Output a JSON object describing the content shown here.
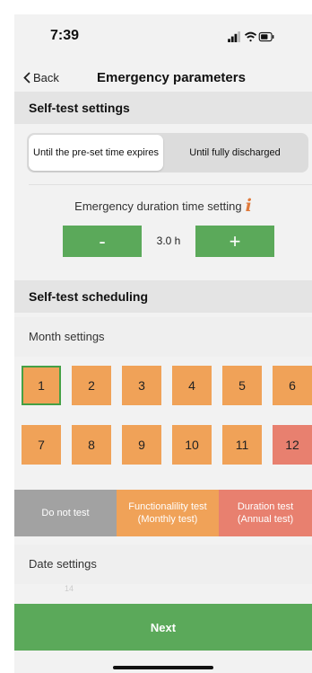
{
  "status_bar": {
    "time": "7:39"
  },
  "nav": {
    "back_label": "Back",
    "title": "Emergency parameters"
  },
  "self_test_settings": {
    "header": "Self-test settings",
    "segments": [
      {
        "label": "Until the pre-set time expires",
        "selected": true
      },
      {
        "label": "Until fully discharged",
        "selected": false
      }
    ],
    "duration_label": "Emergency duration time setting",
    "info_icon": "i",
    "decrement_label": "-",
    "increment_label": "+",
    "duration_value": "3.0 h"
  },
  "self_test_scheduling": {
    "header": "Self-test scheduling",
    "month_settings_label": "Month settings",
    "months": [
      {
        "label": "1",
        "state": "functionality",
        "selected": true
      },
      {
        "label": "2",
        "state": "functionality"
      },
      {
        "label": "3",
        "state": "functionality"
      },
      {
        "label": "4",
        "state": "functionality"
      },
      {
        "label": "5",
        "state": "functionality"
      },
      {
        "label": "6",
        "state": "functionality"
      },
      {
        "label": "7",
        "state": "functionality"
      },
      {
        "label": "8",
        "state": "functionality"
      },
      {
        "label": "9",
        "state": "functionality"
      },
      {
        "label": "10",
        "state": "functionality"
      },
      {
        "label": "11",
        "state": "functionality"
      },
      {
        "label": "12",
        "state": "duration"
      }
    ],
    "legend": {
      "none": "Do not test",
      "functionality_line1": "Functionalility test",
      "functionality_line2": "(Monthly test)",
      "duration_line1": "Duration test",
      "duration_line2": "(Annual test)"
    },
    "date_settings_label": "Date settings",
    "partial_value": "14"
  },
  "footer": {
    "next_label": "Next"
  },
  "colors": {
    "accent_green": "#5ba95a",
    "functionality_orange": "#f0a258",
    "duration_red": "#e8806f",
    "no_test_gray": "#a2a2a2",
    "info_orange": "#e07a3c"
  }
}
